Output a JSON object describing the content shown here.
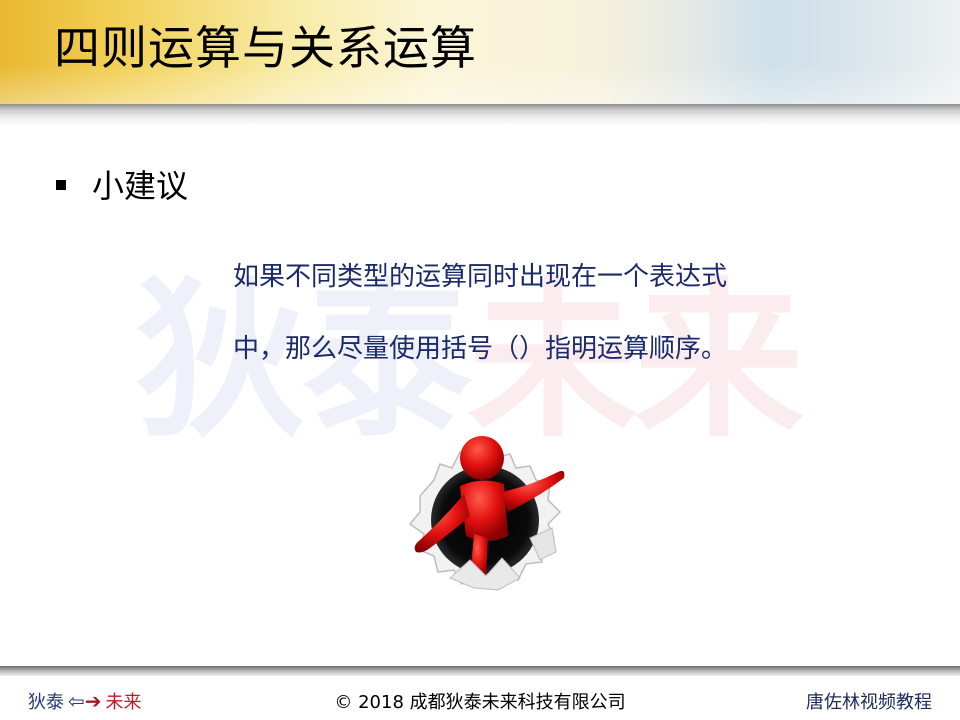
{
  "slide": {
    "title": "四则运算与关系运算",
    "bullet": "小建议",
    "tip_lines": [
      "如果不同类型的运算同时出现在一个表达式",
      "中，那么尽量使用括号（）指明运算顺序。"
    ],
    "watermark": {
      "part1": "狄泰",
      "part2": "未来"
    }
  },
  "footer": {
    "brand_left": "狄泰",
    "brand_right": "未来",
    "copyright": "© 2018 成都狄泰未来科技有限公司",
    "author": "唐佐林视频教程"
  },
  "colors": {
    "title_text": "#000000",
    "tip_text": "#1b2a6b",
    "brand_blue": "#24387d",
    "brand_red": "#c0182a",
    "figure_red": "#e01010"
  },
  "icons": {
    "bullet": "square-bullet",
    "arrow_left": "left-arrow-icon",
    "arrow_right": "right-arrow-icon"
  }
}
